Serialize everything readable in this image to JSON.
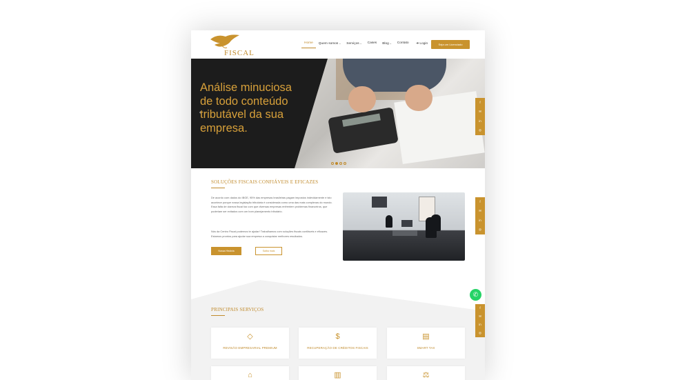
{
  "brand": {
    "logo_text": "FISCAL",
    "accent": "#c9932e"
  },
  "nav": {
    "items": [
      {
        "label": "Home",
        "active": true,
        "caret": false
      },
      {
        "label": "Quem somos",
        "active": false,
        "caret": true
      },
      {
        "label": "Serviços",
        "active": false,
        "caret": true
      },
      {
        "label": "Cases",
        "active": false,
        "caret": false
      },
      {
        "label": "Blog",
        "active": false,
        "caret": true
      },
      {
        "label": "Contato",
        "active": false,
        "caret": false
      }
    ],
    "login_label": "Login",
    "cta_label": "Seja um Licenciado"
  },
  "hero": {
    "title": "Análise minuciosa de todo conteúdo tributável da sua empresa.",
    "slides_count": 4,
    "active_slide": 2
  },
  "about": {
    "title": "SOLUÇÕES FISCAIS CONFIÁVEIS E EFICAZES",
    "paragraph1": "De acordo com dados do IBGE, 95% das empresas brasileiras pagam impostos indevidamente e isto acontece porque nossa legislação tributária é considerada como uma das mais complexas do mundo. Essa falta de clareza fiscal faz com que diversas empresas enfrentem problemas financeiros, que poderiam ser evitados com um bom planejamento tributário.",
    "paragraph2": "Nós da Centro Fiscal podemos te ajudar! Trabalhamos com soluções fiscais confiáveis e eficazes. Estamos prontos para ajudar sua empresa a conquistar melhores resultados.",
    "btn_primary": "Nossa História",
    "btn_secondary": "Saiba mais"
  },
  "services": {
    "title": "PRINCIPAIS SERVIÇOS",
    "cards": [
      {
        "label": "REVISÃO EMPRESARIAL PREMIUM",
        "icon": "diamond-icon",
        "glyph": "◇"
      },
      {
        "label": "RECUPERAÇÃO DE CRÉDITOS FISCAIS",
        "icon": "money-hand-icon",
        "glyph": "$"
      },
      {
        "label": "SMART TAX",
        "icon": "calculator-icon",
        "glyph": "▤"
      },
      {
        "label": "",
        "icon": "house-icon",
        "glyph": "⌂"
      },
      {
        "label": "",
        "icon": "bar-chart-icon",
        "glyph": "▥"
      },
      {
        "label": "",
        "icon": "scale-icon",
        "glyph": "⚖"
      }
    ]
  },
  "social_icons": [
    "facebook-icon",
    "email-icon",
    "linkedin-icon",
    "instagram-icon"
  ],
  "social_glyphs": [
    "f",
    "✉",
    "in",
    "◎"
  ]
}
